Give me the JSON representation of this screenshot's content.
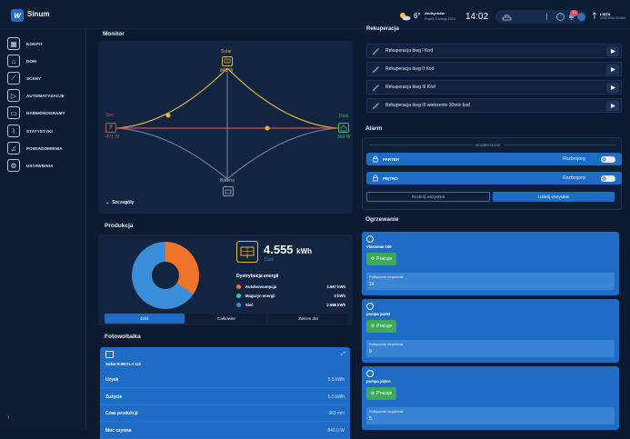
{
  "app": {
    "brand": "Sinum"
  },
  "topbar": {
    "temperature": "6°",
    "location": "Andrychów",
    "date": "Piątek, 2 lutego 2024",
    "time": "14:02",
    "notification_count": "10",
    "list_label": "LISTA",
    "list_sub": "CENTRALI SINUM"
  },
  "sidebar": {
    "items": [
      {
        "label": "KOKPIT",
        "icon": "grid-icon"
      },
      {
        "label": "DOM",
        "icon": "home-icon"
      },
      {
        "label": "SCENY",
        "icon": "wand-icon"
      },
      {
        "label": "AUTOMATYZACJE",
        "icon": "play-circle-icon"
      },
      {
        "label": "HARMONOGRAMY",
        "icon": "calendar-icon"
      },
      {
        "label": "STATYSTYKI",
        "icon": "chart-icon"
      },
      {
        "label": "POWIADOMIENIA",
        "icon": "bell-icon"
      },
      {
        "label": "USTAWIENIA",
        "icon": "gear-icon"
      }
    ]
  },
  "monitor": {
    "title": "Monitor",
    "solar_label": "Solar",
    "solar_value": "840 W",
    "grid_label": "Sieć",
    "grid_value": "-471 W",
    "home_label": "Dom",
    "home_value": "369 W",
    "battery_label": "Bateria",
    "details_label": "Szczegóły"
  },
  "production": {
    "title": "Produkcja",
    "value": "4.555",
    "unit": "kWh",
    "period": "Dziś",
    "distribution_title": "Dystrybucja energii",
    "legend": [
      {
        "label": "Autokonsumpcja",
        "value": "1.567 kWh",
        "color": "#f0742a"
      },
      {
        "label": "Magazyn energii",
        "value": "0 kWh",
        "color": "#3cc9b0"
      },
      {
        "label": "Sieć",
        "value": "2.988 kWh",
        "color": "#3b8ed8"
      }
    ],
    "tabs": [
      "Dziś",
      "Całkowite",
      "Zakres dat"
    ]
  },
  "pv": {
    "title": "Fotowoltaika",
    "device": "Sofar-8-8KTLX-G3",
    "rows": [
      {
        "label": "Uzysk",
        "value": "5.5 kWh"
      },
      {
        "label": "Zużycie",
        "value": "5.5 kWh"
      },
      {
        "label": "Czas produkcji",
        "value": "363 min"
      },
      {
        "label": "Moc czynna",
        "value": "840.0 W"
      }
    ]
  },
  "recuperation": {
    "title": "Rekuperacja",
    "items": [
      "Rekuperacja bieg I Kod",
      "Rekuperacja bieg II Kod",
      "Rekuperacja bieg III Kod",
      "Rekuperacja bieg III wietrzenie 30min kod"
    ]
  },
  "alarm": {
    "title": "Alarm",
    "status_header": "ROZBROJONE",
    "zones": [
      {
        "name": "PARTER",
        "state": "Rozbrojony"
      },
      {
        "name": "PIĘTRO",
        "state": "Rozbrojony"
      }
    ],
    "disarm_all": "Rozbrój wszystkie",
    "arm_all": "Uzbrój wszystkie"
  },
  "heating": {
    "title": "Ogrzewanie",
    "devices": [
      {
        "name": "Viessman 100",
        "button": "Pracuje",
        "info_label": "Podłączone urządzenia",
        "info_value": "14"
      },
      {
        "name": "pompa parter",
        "button": "Pracuje",
        "info_label": "Podłączone urządzenia",
        "info_value": "9"
      },
      {
        "name": "pompa piętro",
        "button": "Pracuje",
        "info_label": "Podłączone urządzenia",
        "info_value": "5"
      }
    ]
  },
  "colors": {
    "accent": "#1f6cc7",
    "background": "#0b1a30",
    "panel": "#112440",
    "solar_line": "#e8b53a",
    "grid_line": "#e04a4a",
    "home": "#3dbf6a"
  }
}
